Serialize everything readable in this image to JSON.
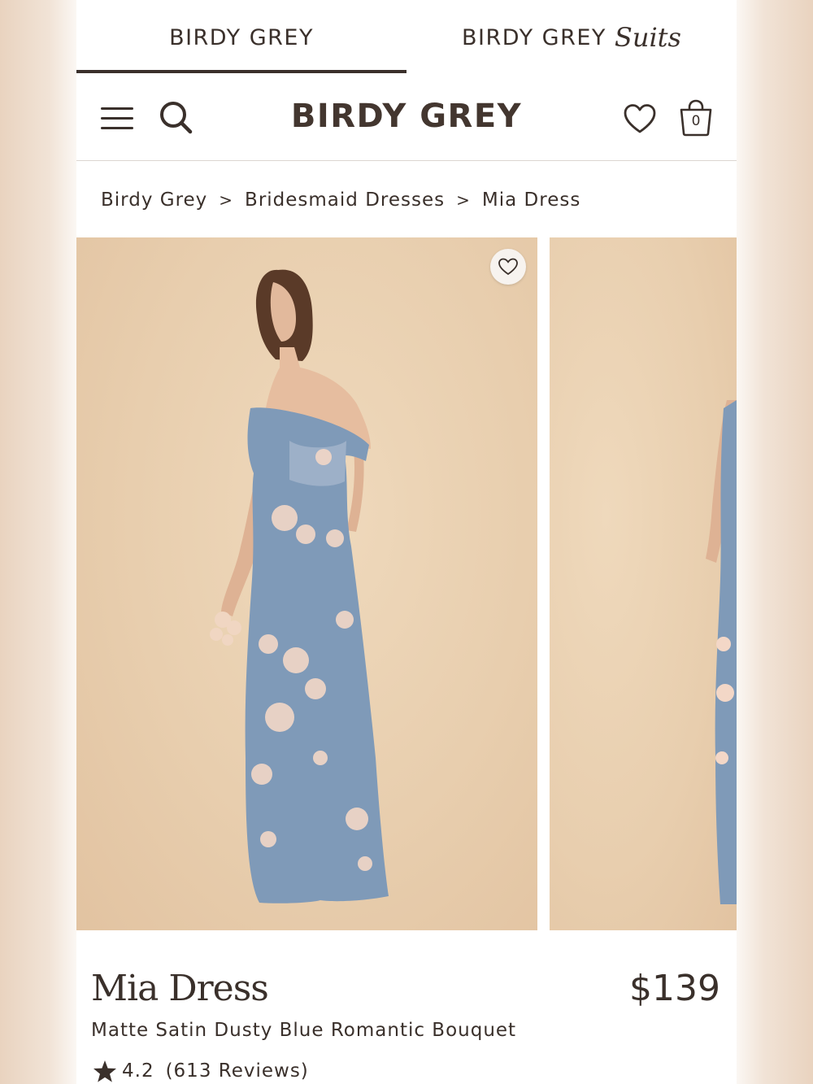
{
  "brand_tabs": {
    "primary": "BIRDY GREY",
    "secondary_prefix": "BIRDY GREY",
    "secondary_script": "Suits"
  },
  "header": {
    "logo": "BIRDY GREY",
    "bag_count": "0",
    "icons": [
      "hamburger-menu-icon",
      "search-icon",
      "heart-icon",
      "shopping-bag-icon"
    ]
  },
  "breadcrumb": {
    "items": [
      "Birdy Grey",
      "Bridesmaid Dresses",
      "Mia Dress"
    ],
    "separator": ">"
  },
  "product": {
    "name": "Mia Dress",
    "price": "$139",
    "variant": "Matte Satin Dusty Blue Romantic Bouquet",
    "rating": "4.2",
    "reviews": "(613 Reviews)"
  },
  "colors": {
    "text": "#3a302b",
    "backdrop": "#e8ceae",
    "dress": "#7f9ab8"
  }
}
